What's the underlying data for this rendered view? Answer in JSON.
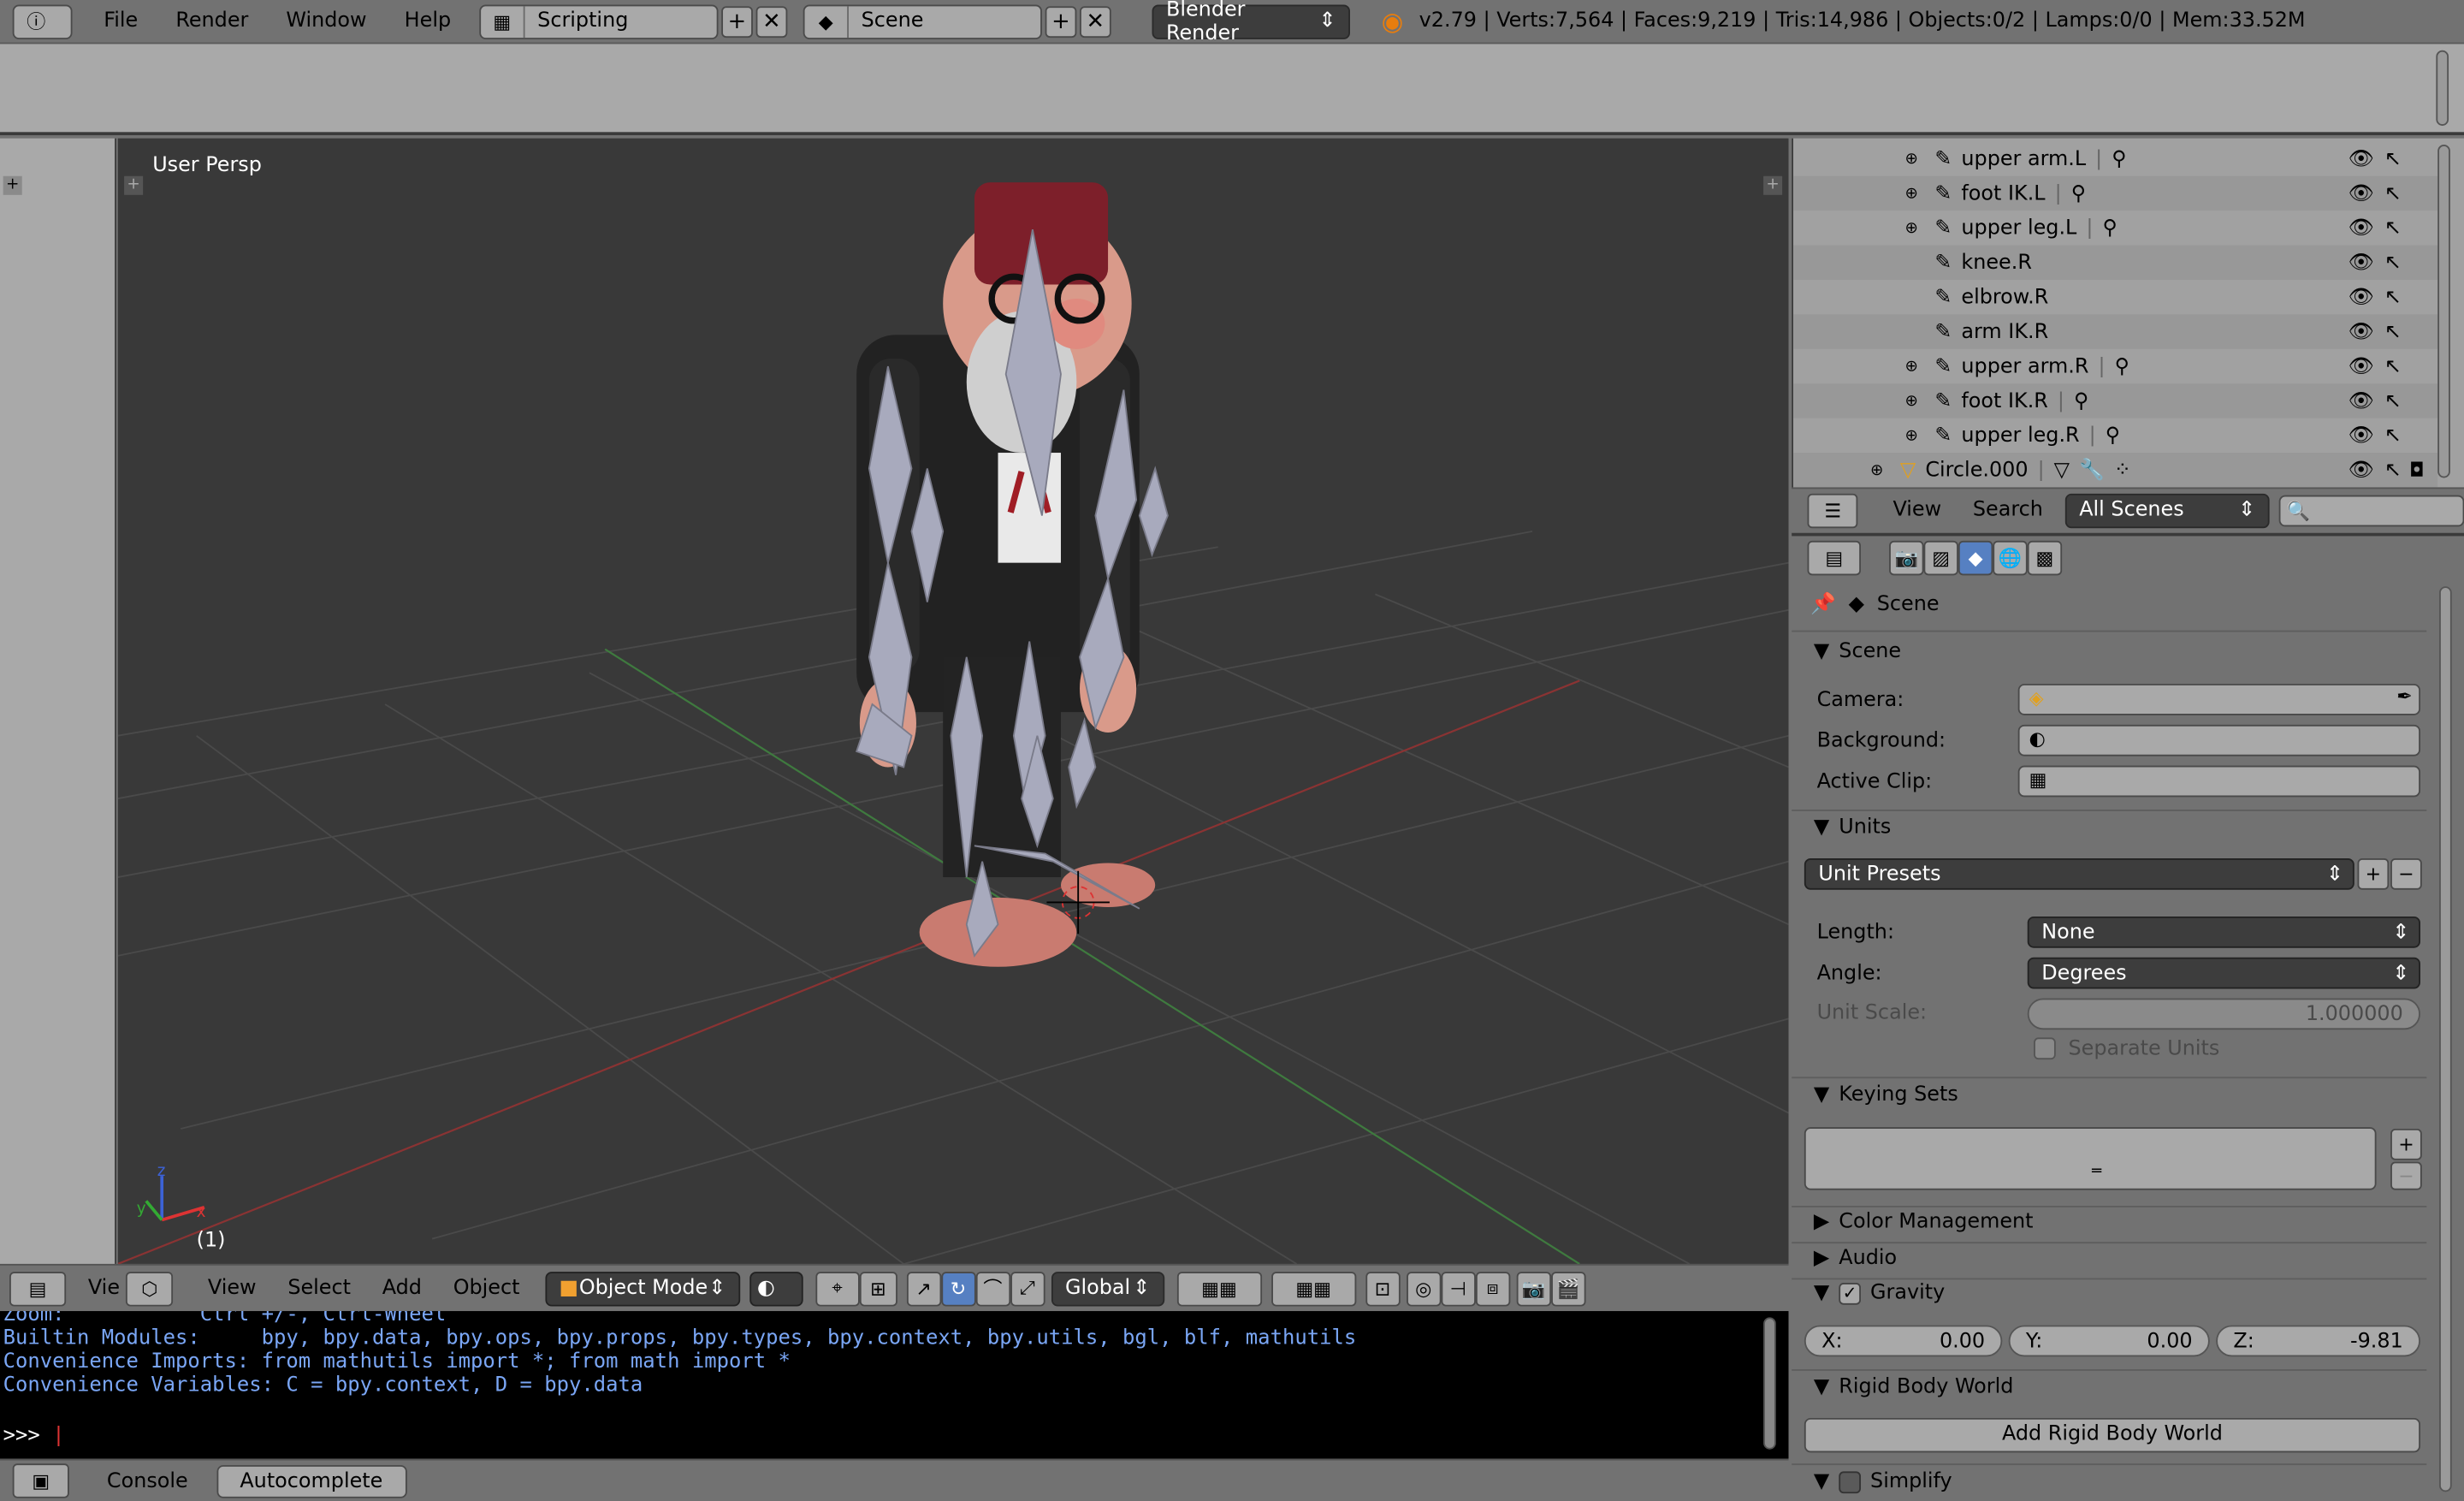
{
  "topbar": {
    "menus": [
      "File",
      "Render",
      "Window",
      "Help"
    ],
    "screen_layout": "Scripting",
    "scene": "Scene",
    "render_engine": "Blender Render",
    "stats": "v2.79 | Verts:7,564 | Faces:9,219 | Tris:14,986 | Objects:0/2 | Lamps:0/0 | Mem:33.52M"
  },
  "viewport": {
    "title": "User Persp",
    "frame": "(1)"
  },
  "viewport_header": {
    "view_abbrev": "Vie",
    "menus": [
      "View",
      "Select",
      "Add",
      "Object"
    ],
    "mode": "Object Mode",
    "orientation": "Global"
  },
  "console": {
    "lines": [
      "Zoom:           Ctrl +/-, Ctrl-Wheel",
      "Builtin Modules:     bpy, bpy.data, bpy.ops, bpy.props, bpy.types, bpy.context, bpy.utils, bgl, blf, mathutils",
      "Convenience Imports: from mathutils import *; from math import *",
      "Convenience Variables: C = bpy.context, D = bpy.data"
    ],
    "prompt": ">>> ",
    "header_console": "Console",
    "header_autocomplete": "Autocomplete"
  },
  "outliner": {
    "items": [
      {
        "name": "upper arm.L",
        "expand": true
      },
      {
        "name": "foot IK.L",
        "expand": true
      },
      {
        "name": "upper leg.L",
        "expand": true
      },
      {
        "name": "knee.R",
        "expand": false
      },
      {
        "name": "elbrow.R",
        "expand": false
      },
      {
        "name": "arm IK.R",
        "expand": false
      },
      {
        "name": "upper arm.R",
        "expand": true
      },
      {
        "name": "foot IK.R",
        "expand": true
      },
      {
        "name": "upper leg.R",
        "expand": true
      },
      {
        "name": "Circle.000",
        "expand": true
      }
    ],
    "header": {
      "view": "View",
      "search": "Search",
      "filter": "All Scenes"
    }
  },
  "properties": {
    "context": "Scene",
    "scene_panel": {
      "title": "Scene",
      "camera_label": "Camera:",
      "background_label": "Background:",
      "active_clip_label": "Active Clip:"
    },
    "units_panel": {
      "title": "Units",
      "presets": "Unit Presets",
      "length_label": "Length:",
      "length_value": "None",
      "angle_label": "Angle:",
      "angle_value": "Degrees",
      "unit_scale_label": "Unit Scale:",
      "unit_scale_value": "1.000000",
      "separate_units": "Separate Units"
    },
    "keying_sets": "Keying Sets",
    "color_management": "Color Management",
    "audio": "Audio",
    "gravity": {
      "title": "Gravity",
      "x_label": "X:",
      "x": "0.00",
      "y_label": "Y:",
      "y": "0.00",
      "z_label": "Z:",
      "z": "-9.81"
    },
    "rigid_body_world": "Rigid Body World",
    "add_rigid_body_world": "Add Rigid Body World",
    "simplify": "Simplify"
  }
}
